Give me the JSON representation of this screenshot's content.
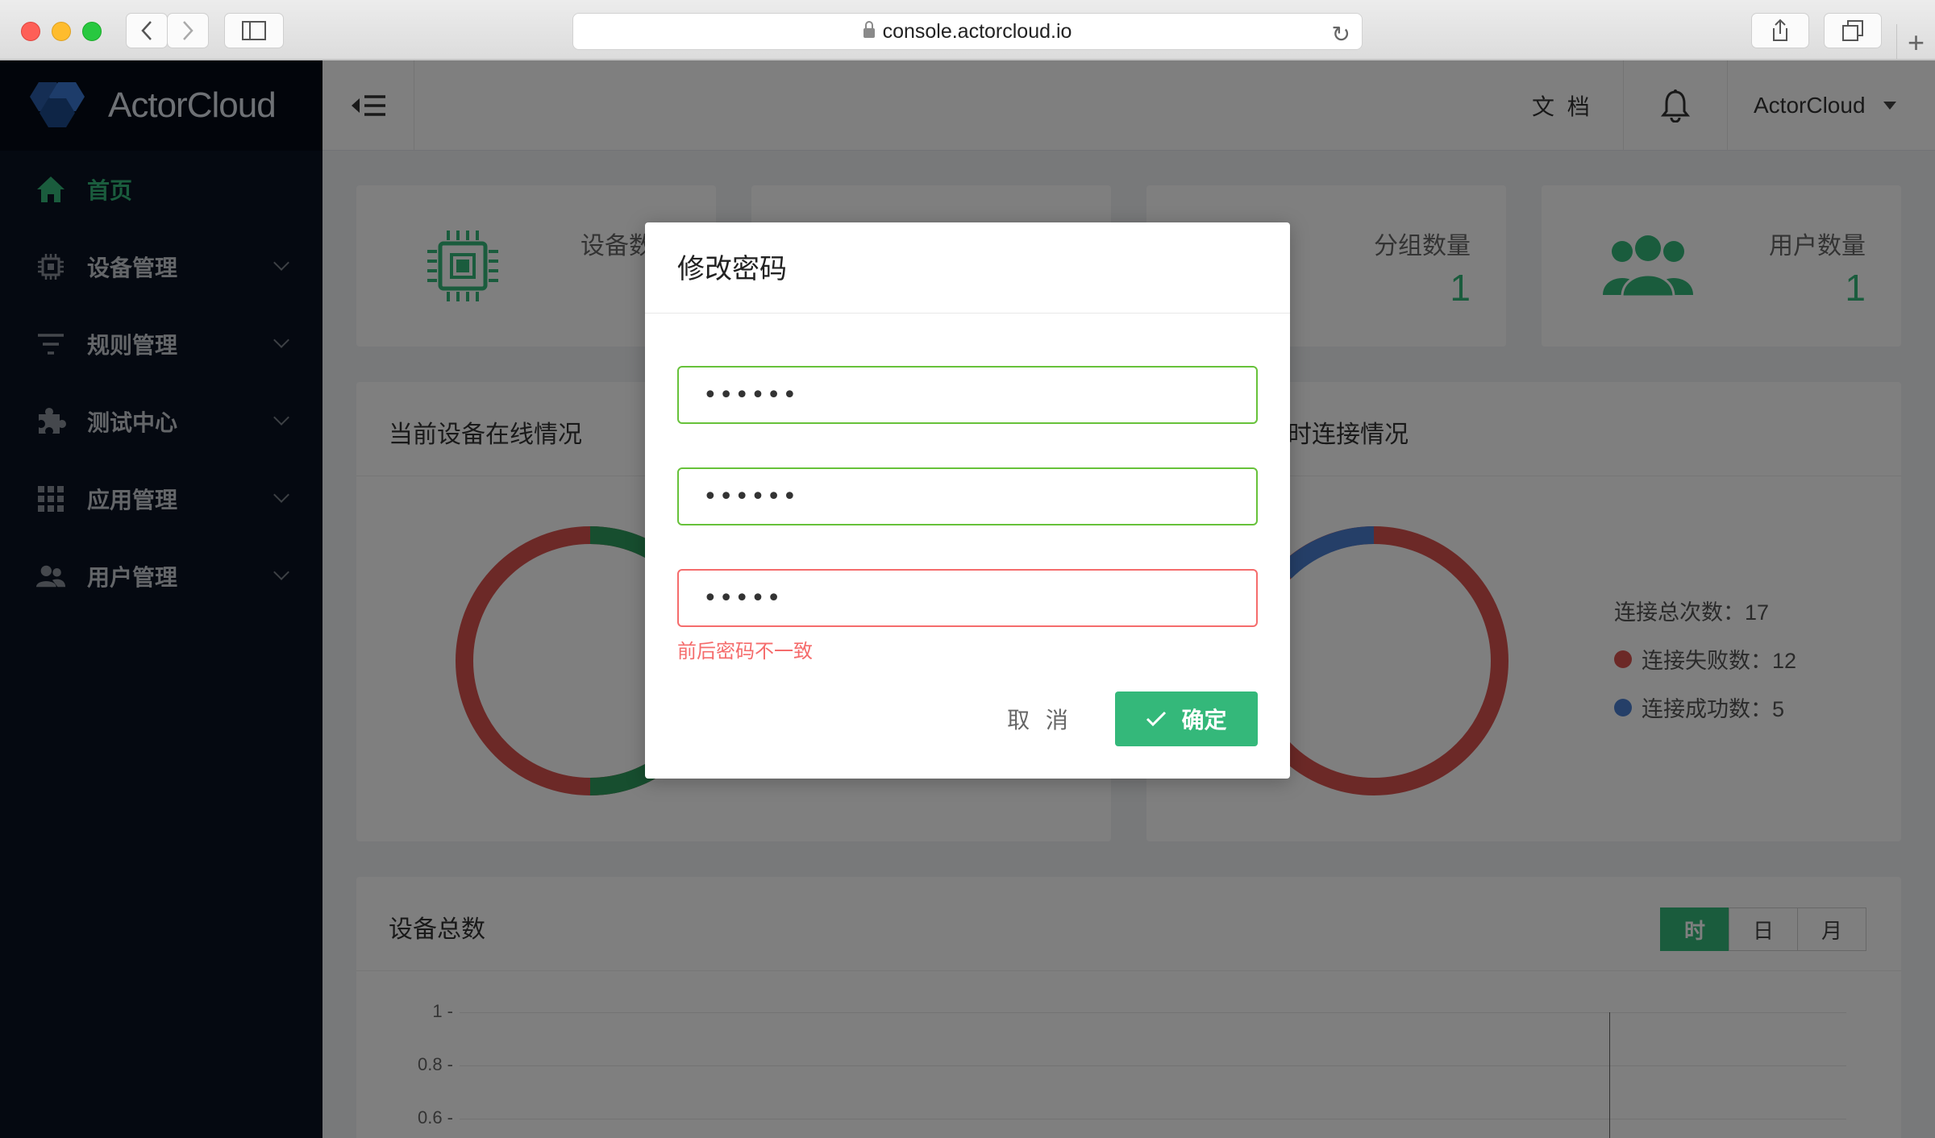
{
  "browser": {
    "url": "console.actorcloud.io"
  },
  "sidebar": {
    "brand": "ActorCloud",
    "items": [
      {
        "label": "首页",
        "icon": "home-icon",
        "active": true
      },
      {
        "label": "设备管理",
        "icon": "chip-icon"
      },
      {
        "label": "规则管理",
        "icon": "filter-icon"
      },
      {
        "label": "测试中心",
        "icon": "puzzle-icon"
      },
      {
        "label": "应用管理",
        "icon": "grid-icon"
      },
      {
        "label": "用户管理",
        "icon": "users-icon"
      }
    ]
  },
  "header": {
    "docs_label": "文 档",
    "user_name": "ActorCloud"
  },
  "stats": [
    {
      "label": "设备数"
    },
    {
      "label": ""
    },
    {
      "label": "分组数量",
      "value": "1"
    },
    {
      "label": "用户数量",
      "value": "1"
    }
  ],
  "online_panel": {
    "title": "当前设备在线情况"
  },
  "connect_panel": {
    "title": "时连接情况",
    "total_label": "连接总次数：17",
    "fail_label": "连接失败数：12",
    "success_label": "连接成功数：5"
  },
  "devices_panel": {
    "title": "设备总数",
    "tabs": [
      "时",
      "日",
      "月"
    ],
    "active_tab": "时",
    "y_ticks": [
      "1 -",
      "0.8 -",
      "0.6 -"
    ]
  },
  "modal": {
    "title": "修改密码",
    "field1": "••••••",
    "field2": "••••••",
    "field3": "•••••",
    "error": "前后密码不一致",
    "cancel_label": "取 消",
    "ok_label": "确定"
  },
  "colors": {
    "accent": "#34b87a",
    "sidebar": "#0a1322",
    "donut_red": "#d9534f",
    "donut_green": "#2e9c5f",
    "donut_blue": "#4a7fd0",
    "error": "#f56c6c",
    "valid": "#67c23a"
  }
}
